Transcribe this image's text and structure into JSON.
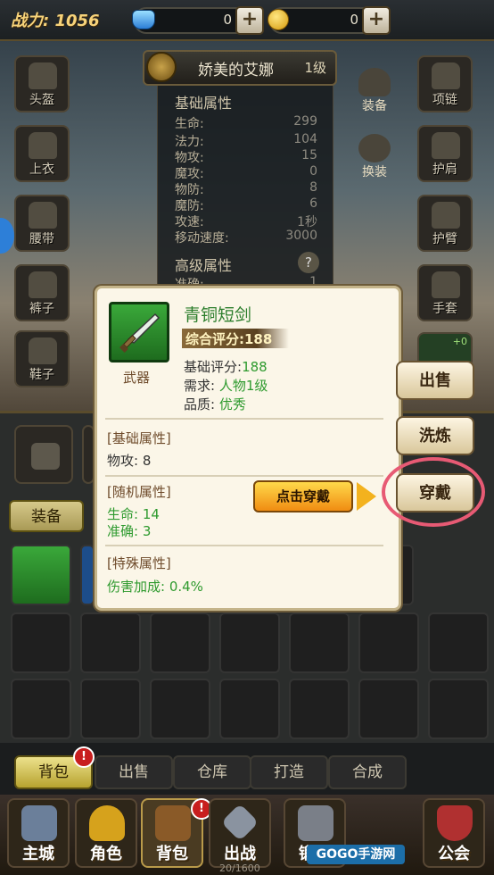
{
  "top": {
    "power_label": "战力:",
    "power_value": "1056",
    "gems": "0",
    "gold": "0",
    "plus": "+"
  },
  "hero": {
    "name": "娇美的艾娜",
    "level": "1级"
  },
  "left_slots": [
    "头盔",
    "上衣",
    "腰带",
    "裤子",
    "鞋子"
  ],
  "right_slots": [
    "项链",
    "护肩",
    "护臂",
    "手套"
  ],
  "mid_actions": {
    "equip": "装备",
    "change": "换装"
  },
  "basic_attrs": {
    "title": "基础属性",
    "rows": [
      {
        "k": "生命:",
        "v": "299"
      },
      {
        "k": "法力:",
        "v": "104"
      },
      {
        "k": "物攻:",
        "v": "15"
      },
      {
        "k": "魔攻:",
        "v": "0"
      },
      {
        "k": "物防:",
        "v": "8"
      },
      {
        "k": "魔防:",
        "v": "6"
      },
      {
        "k": "攻速:",
        "v": "1秒"
      },
      {
        "k": "移动速度:",
        "v": "3000"
      }
    ],
    "adv_title": "高级属性",
    "help": "?",
    "partial_row": {
      "k": "准确:",
      "v": "1"
    }
  },
  "under_tab": "装备",
  "item": {
    "name": "青铜短剑",
    "type": "武器",
    "score_label": "综合评分:",
    "score": "188",
    "base_score_label": "基础评分:",
    "base_score": "188",
    "req_label": "需求:",
    "req": "人物1级",
    "quality_label": "品质:",
    "quality": "优秀",
    "sec_basic": "[基础属性]",
    "basic_line": "物攻:  8",
    "sec_random": "[随机属性]",
    "random_lines": [
      "生命:  14",
      "准确:  3"
    ],
    "sec_special": "[特殊属性]",
    "special_line": "伤害加成:  0.4%"
  },
  "actions": {
    "sell": "出售",
    "refine": "洗炼",
    "wear": "穿戴",
    "tip": "点击穿戴"
  },
  "badge_plus": "+0",
  "bag_tabs": [
    "背包",
    "出售",
    "仓库",
    "打造",
    "合成"
  ],
  "badge": "!",
  "nav": [
    "主城",
    "角色",
    "背包",
    "出战",
    "锻造",
    "公会"
  ],
  "counter": "20/1600",
  "watermark": "GOGO手游网"
}
